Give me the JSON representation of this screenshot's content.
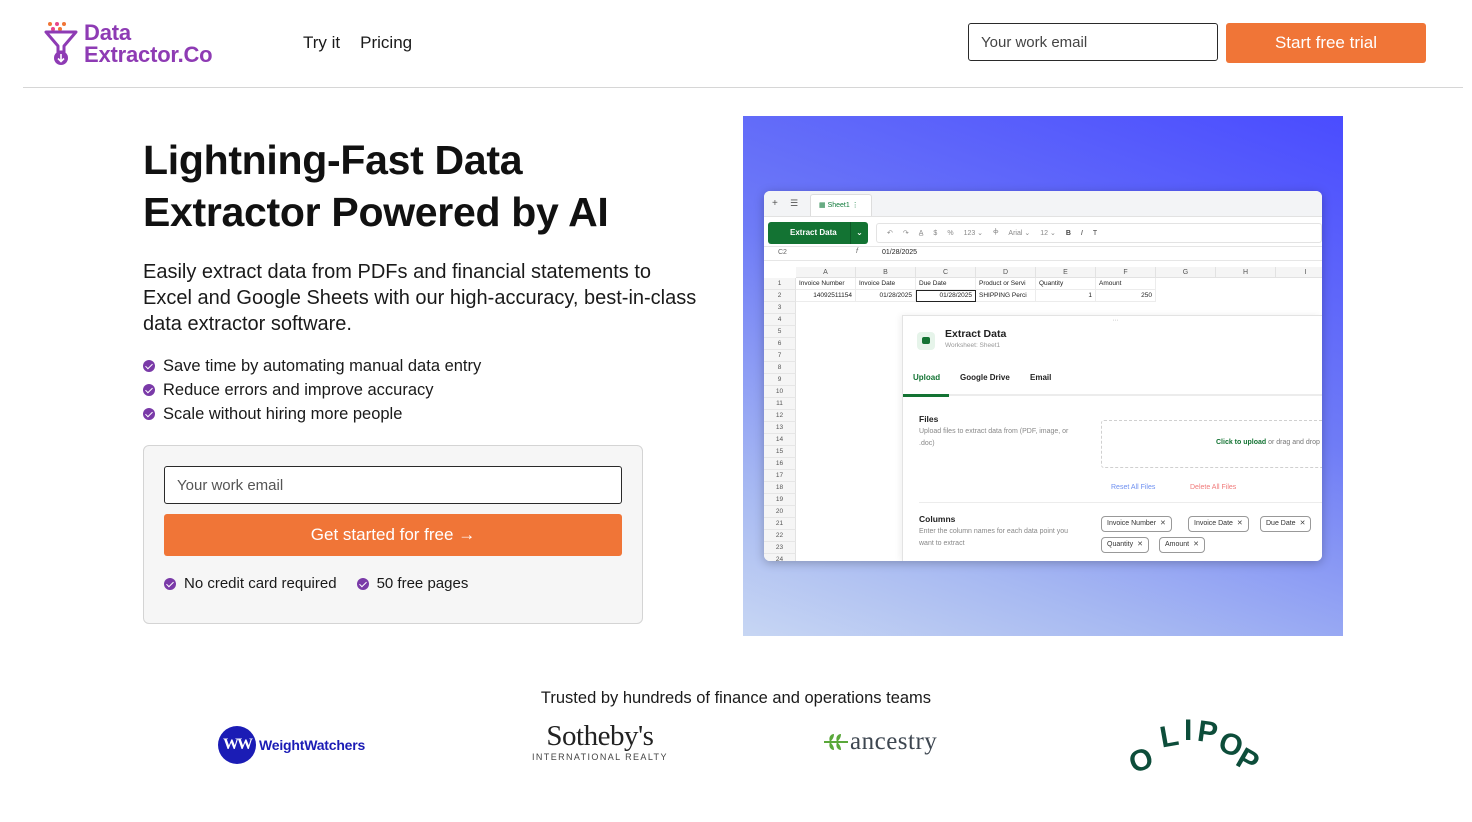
{
  "header": {
    "logo_line1": "Data",
    "logo_line2": "Extractor.Co",
    "nav": [
      "Try it",
      "Pricing"
    ],
    "email_placeholder": "Your work email",
    "cta_label": "Start free trial"
  },
  "hero": {
    "title": "Lightning-Fast Data Extractor Powered by AI",
    "subtitle": "Easily extract data from PDFs and financial statements to Excel and Google Sheets with our high-accuracy, best-in-class data extractor software.",
    "bullets": [
      "Save time by automating manual data entry",
      "Reduce errors and improve accuracy",
      "Scale without hiring more people"
    ],
    "card": {
      "email_placeholder": "Your work email",
      "cta_label": "Get started for free →",
      "notes": [
        "No credit card required",
        "50 free pages"
      ]
    }
  },
  "illustration": {
    "sheet_tab": "Sheet1",
    "extract_button": "Extract Data",
    "toolbar": [
      "↶",
      "↷",
      "A̲",
      "$",
      "%",
      "123 ⌄",
      "Ⲫ",
      "Arial ⌄",
      "12 ⌄",
      "B",
      "I",
      "T"
    ],
    "cell_ref": "C2",
    "formula_value": "01/28/2025",
    "columns": [
      "A",
      "B",
      "C",
      "D",
      "E",
      "F",
      "G",
      "H",
      "I"
    ],
    "header_row": [
      "Invoice Number",
      "Invoice Date",
      "Due Date",
      "Product or Servi",
      "Quantity",
      "Amount"
    ],
    "data_row": [
      "14092511154",
      "01/28/2025",
      "01/28/2025",
      "SHIPPING Perci",
      "1",
      "250"
    ],
    "row_numbers": [
      "1",
      "2",
      "3",
      "4",
      "5",
      "6",
      "7",
      "8",
      "9",
      "10",
      "11",
      "12",
      "13",
      "14",
      "15",
      "16",
      "17",
      "18",
      "19",
      "20",
      "21",
      "22",
      "23",
      "24"
    ],
    "panel": {
      "title": "Extract Data",
      "subtitle": "Worksheet: Sheet1",
      "tabs": [
        "Upload",
        "Google Drive",
        "Email"
      ],
      "files_heading": "Files",
      "files_desc": "Upload files to extract data from (PDF, image, or .doc)",
      "drop_link": "Click to upload",
      "drop_rest": " or drag and drop",
      "reset": "Reset All Files",
      "delete": "Delete All Files",
      "columns_heading": "Columns",
      "columns_desc": "Enter the column names for each data point you want to extract",
      "chips": [
        "Invoice Number",
        "Invoice Date",
        "Due Date",
        "Quantity",
        "Amount"
      ]
    }
  },
  "trust": {
    "heading": "Trusted by hundreds of finance and operations teams",
    "logos": {
      "weightwatchers": "WeightWatchers",
      "weightwatchers_mark": "WW",
      "sothebys": "Sotheby's",
      "sothebys_sub": "INTERNATIONAL REALTY",
      "ancestry": "ancestry",
      "olipop": "OLIPOP"
    }
  },
  "colors": {
    "accent": "#f07537",
    "brand_purple": "#8e3bb4",
    "check_purple": "#7a3aa8",
    "sheets_green": "#137333"
  }
}
